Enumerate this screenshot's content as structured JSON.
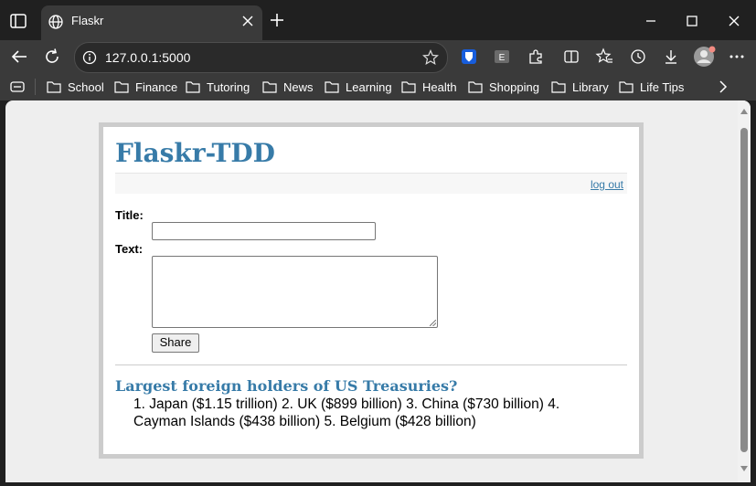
{
  "browser": {
    "tab": {
      "title": "Flaskr"
    },
    "address": {
      "url": "127.0.0.1:5000"
    },
    "bookmarks": [
      "School",
      "Finance",
      "Tutoring",
      "News",
      "Learning",
      "Health",
      "Shopping",
      "Library",
      "Life Tips"
    ]
  },
  "page": {
    "heading": "Flaskr-TDD",
    "logout_label": "log out",
    "form": {
      "title_label": "Title:",
      "text_label": "Text:",
      "title_value": "",
      "text_value": "",
      "share_label": "Share"
    },
    "entries": [
      {
        "title": "Largest foreign holders of US Treasuries?",
        "text": "1. Japan ($1.15 trillion) 2. UK ($899 billion) 3. China ($730 billion) 4. Cayman Islands ($438 billion) 5. Belgium ($428 billion)"
      }
    ]
  },
  "colors": {
    "link": "#377ba8",
    "chrome_dark": "#202020",
    "chrome_bar": "#3a3a3a"
  }
}
